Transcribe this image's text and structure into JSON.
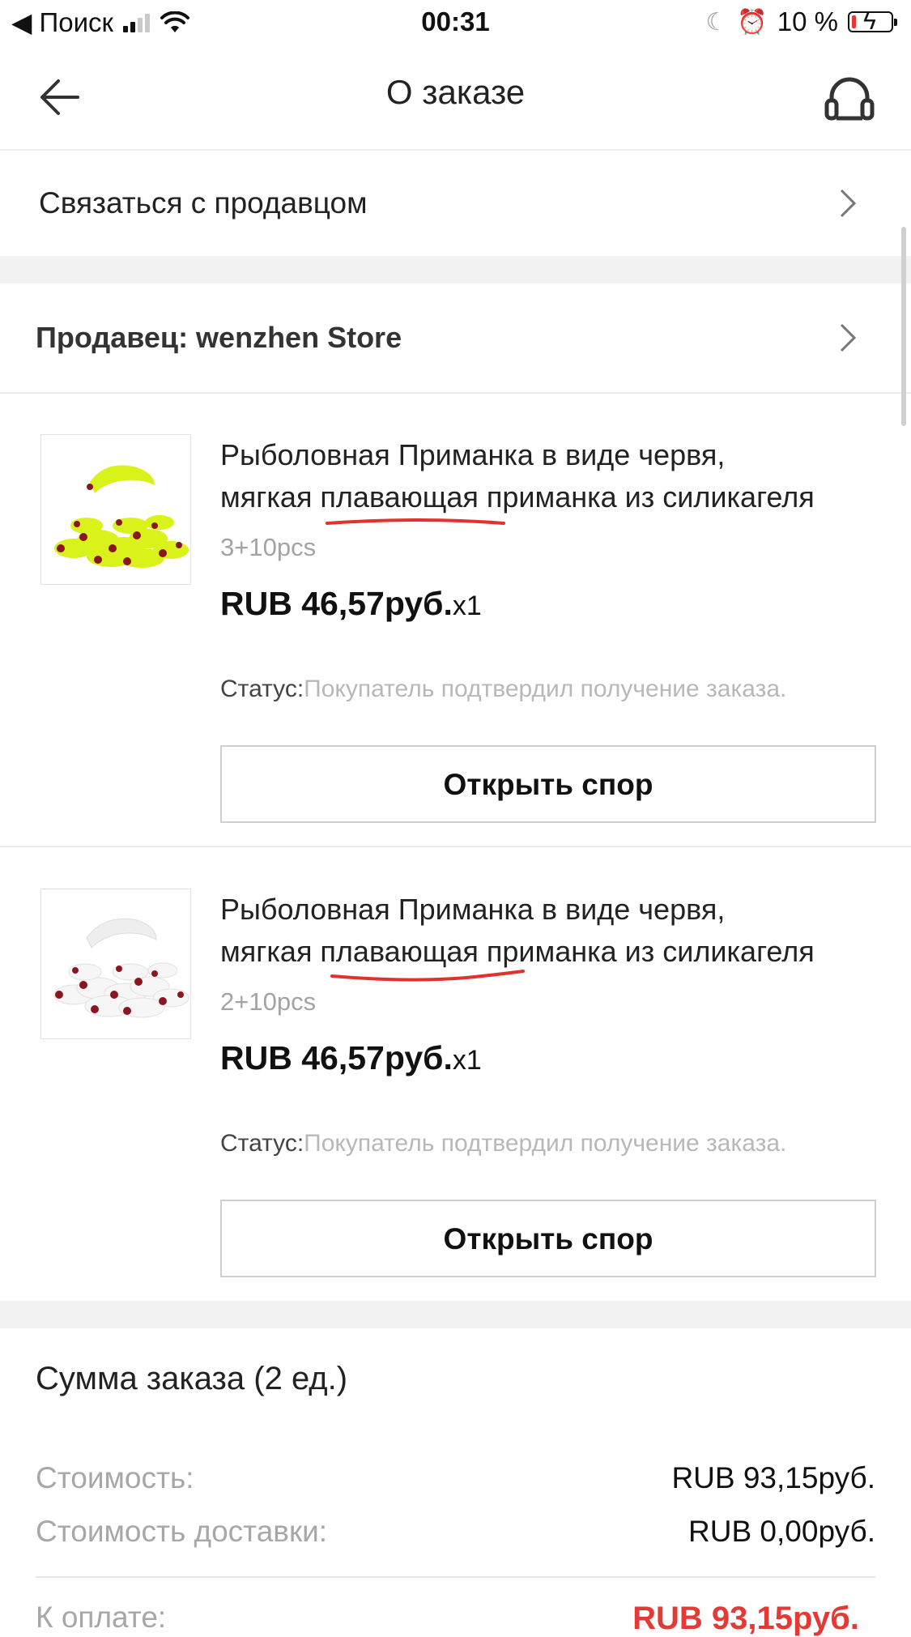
{
  "status_bar": {
    "back_label": "◀ Поиск",
    "time": "00:31",
    "battery_text": "10 %"
  },
  "nav": {
    "title": "О заказе",
    "back_icon": "arrow-left-icon",
    "support_icon": "headset-icon"
  },
  "contact_seller": {
    "label": "Связаться с продавцом"
  },
  "seller": {
    "label": "Продавец: wenzhen Store"
  },
  "products": [
    {
      "title_line1": "Рыболовная Приманка в виде червя,",
      "title_line2": "мягкая плавающая приманка из силикагеля",
      "variant": "3+10pcs",
      "price": "RUB 46,57руб.",
      "qty": "x1",
      "status_label": "Статус:",
      "status_value": "Покупатель подтвердил получение заказа.",
      "button": "Открыть спор",
      "thumb_color": "#d9f21a"
    },
    {
      "title_line1": "Рыболовная Приманка в виде червя,",
      "title_line2": "мягкая плавающая приманка из силикагеля",
      "variant": "2+10pcs",
      "price": "RUB 46,57руб.",
      "qty": "x1",
      "status_label": "Статус:",
      "status_value": "Покупатель подтвердил получение заказа.",
      "button": "Открыть спор",
      "thumb_color": "#f3f3f3"
    }
  ],
  "summary": {
    "title": "Сумма заказа (2 ед.)",
    "cost_label": "Стоимость:",
    "cost_value": "RUB 93,15руб.",
    "shipping_label": "Стоимость доставки:",
    "shipping_value": "RUB 0,00руб.",
    "total_label": "К оплате:",
    "total_value": "RUB 93,15руб."
  },
  "colors": {
    "accent_red": "#e53935",
    "muted_text": "#a7a7a7",
    "divider": "#ededed",
    "annotation_underline": "#e0332f"
  }
}
